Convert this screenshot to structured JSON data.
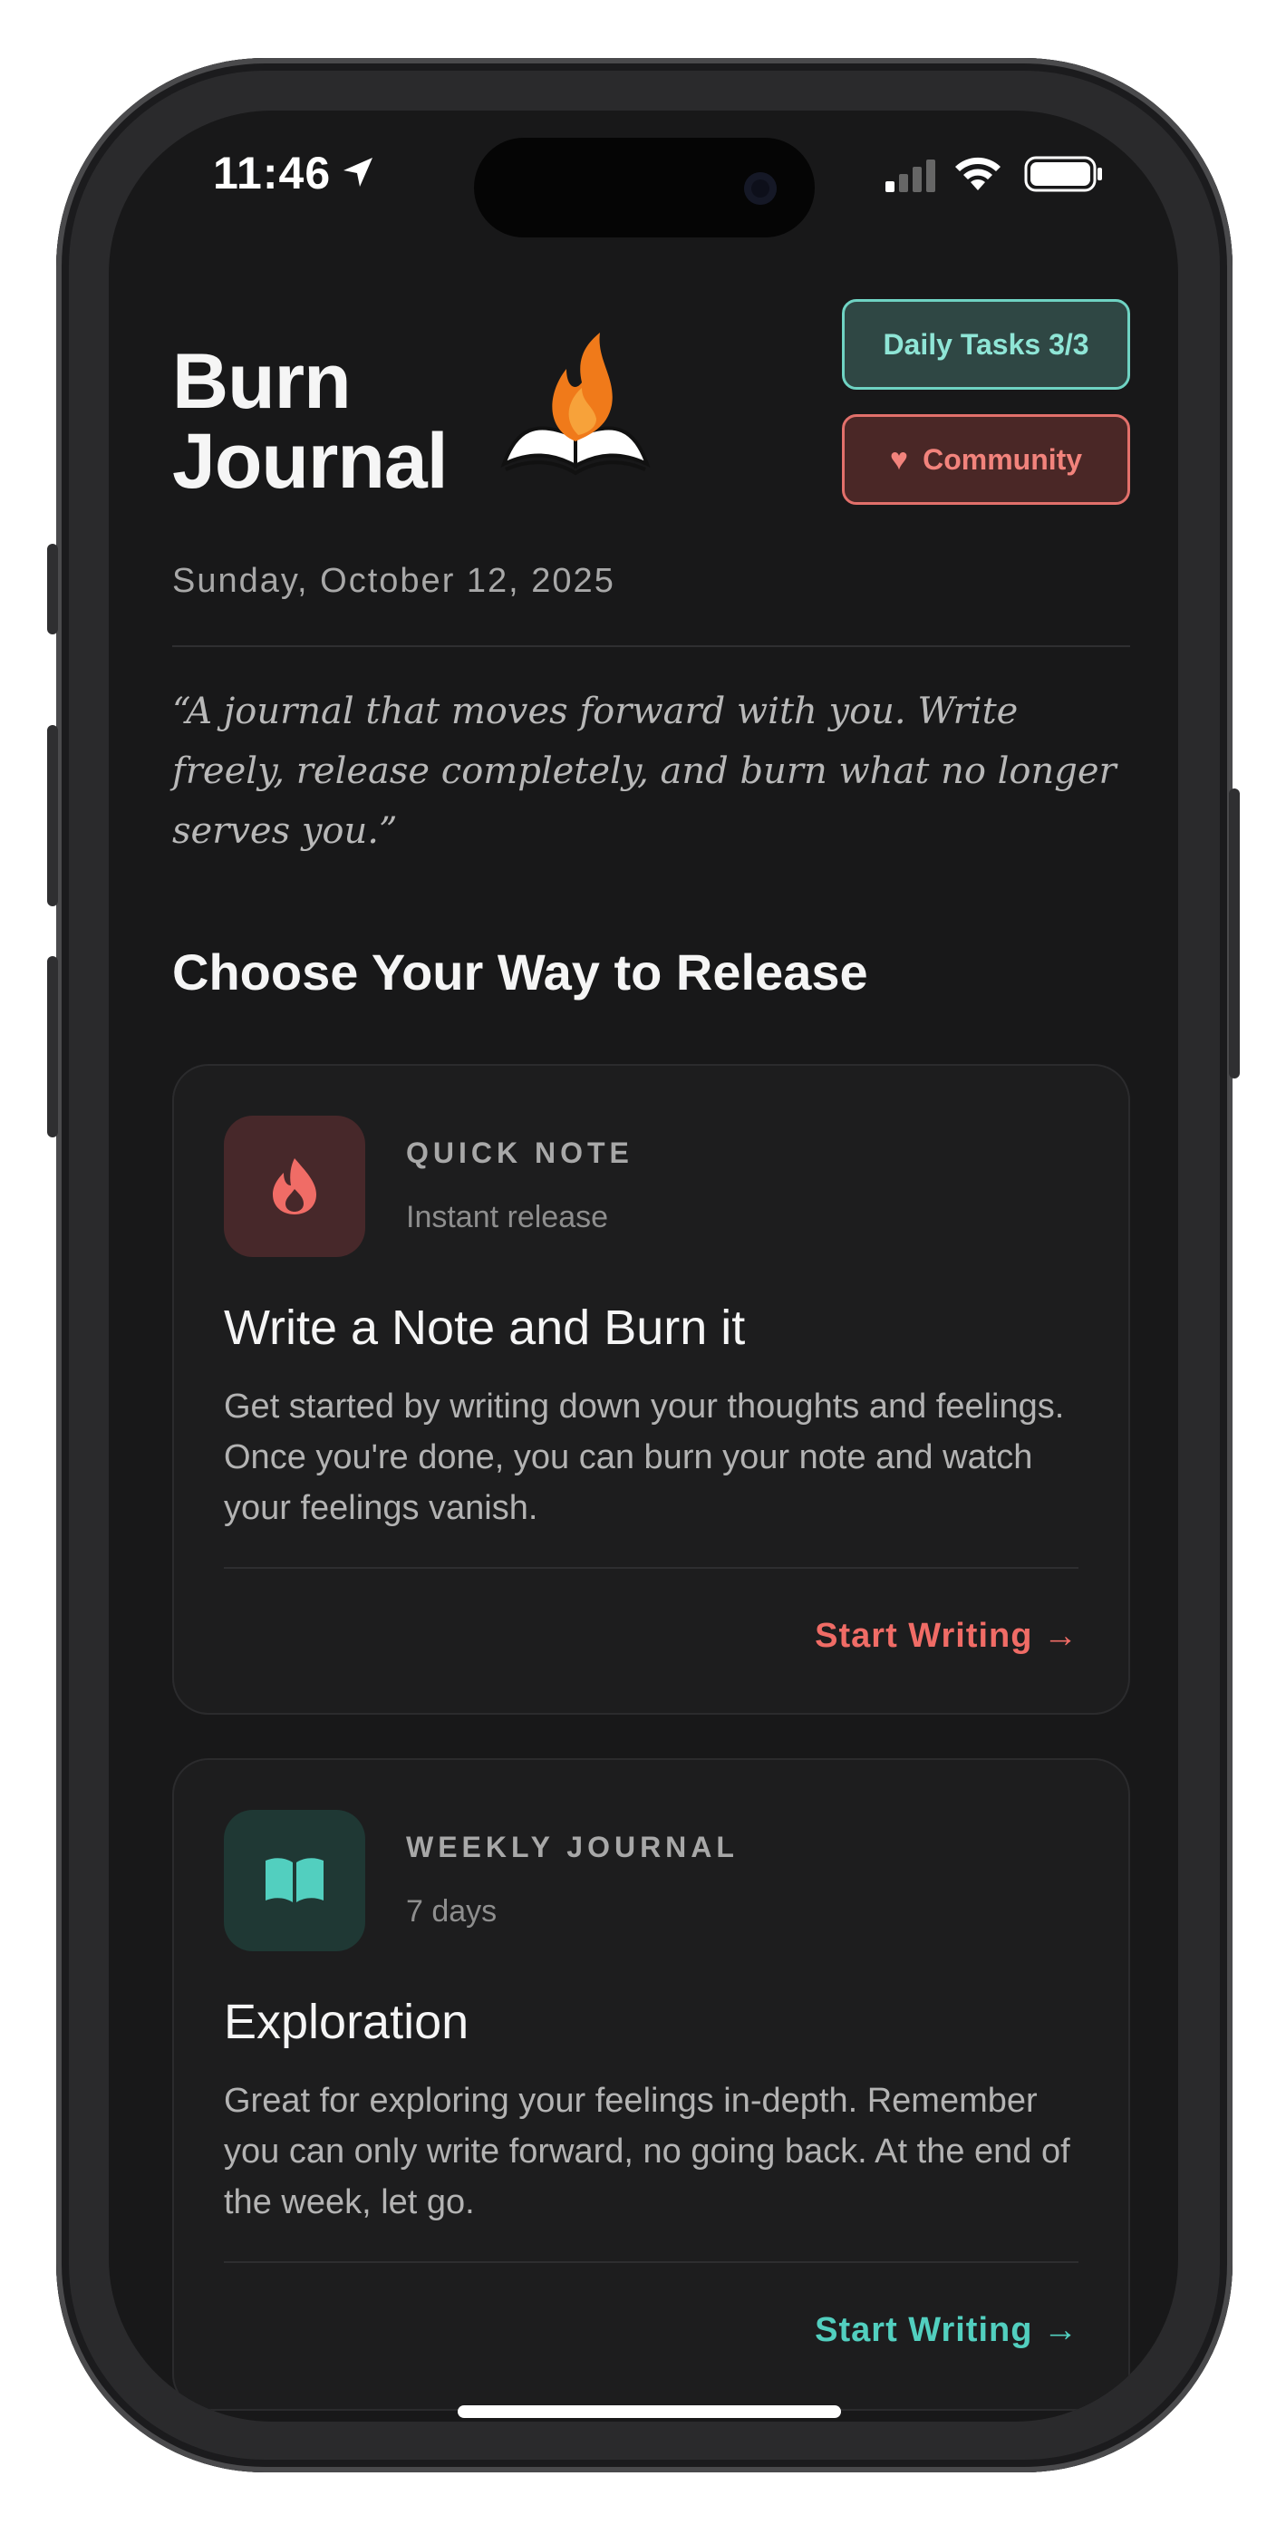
{
  "status_bar": {
    "time": "11:46",
    "icons": [
      "location-arrow-icon",
      "cellular-signal-icon",
      "wifi-icon",
      "battery-icon"
    ]
  },
  "header": {
    "title_line1": "Burn",
    "title_line2": "Journal",
    "logo_icon": "burning-book-logo",
    "daily_tasks_label": "Daily Tasks 3/3",
    "community_label": "Community",
    "community_icon": "heart-icon"
  },
  "date": "Sunday, October 12, 2025",
  "quote": "“A journal that moves forward with you. Write freely, release completely, and burn what no longer serves you.”",
  "section_title": "Choose Your Way to Release",
  "cards": [
    {
      "icon": "flame-icon",
      "kicker": "QUICK NOTE",
      "sub": "Instant release",
      "heading": "Write a Note and Burn it",
      "description": "Get started by writing down your thoughts and feelings. Once you're done, you can burn your note and watch your feelings vanish.",
      "cta": "Start Writing →",
      "accent": "#f06c66"
    },
    {
      "icon": "open-book-icon",
      "kicker": "WEEKLY JOURNAL",
      "sub": "7 days",
      "heading": "Exploration",
      "description": "Great for exploring your feelings in-depth. Remember you can only write forward, no going back. At the end of the week, let go.",
      "cta": "Start Writing →",
      "accent": "#52cfbf"
    }
  ],
  "colors": {
    "background": "#181819",
    "card": "#1d1d1e",
    "tasks_accent": "#6fd3c3",
    "community_accent": "#e2706b"
  }
}
